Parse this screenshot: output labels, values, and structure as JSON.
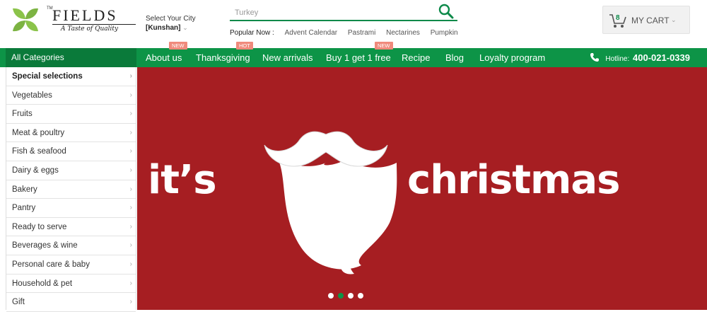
{
  "brand": {
    "tm": "TM",
    "name": "FIELDS",
    "tagline": "A Taste of Quality",
    "color": "#7cb342"
  },
  "city": {
    "label": "Select Your City",
    "current": "[Kunshan]"
  },
  "search": {
    "placeholder": "Turkey",
    "icon": "search-icon"
  },
  "popular": {
    "label": "Popular Now :",
    "tags": [
      "Advent Calendar",
      "Pastrami",
      "Nectarines",
      "Pumpkin"
    ]
  },
  "cart": {
    "count": "8",
    "label": "MY CART",
    "icon": "cart-icon"
  },
  "nav": {
    "all_categories": "All Categories",
    "items": [
      {
        "label": "About us",
        "badge": "NEW"
      },
      {
        "label": "Thanksgiving",
        "badge": "HOT"
      },
      {
        "label": "New arrivals",
        "badge": ""
      },
      {
        "label": "Buy 1 get 1 free",
        "badge": "NEW"
      },
      {
        "label": "Recipe",
        "badge": ""
      },
      {
        "label": "Blog",
        "badge": ""
      },
      {
        "label": "Loyalty program",
        "badge": ""
      }
    ],
    "hotline_label": "Hotline:",
    "hotline_number": "400-021-0339",
    "color": "#0d9447"
  },
  "categories": [
    "Special selections",
    "Vegetables",
    "Fruits",
    "Meat & poultry",
    "Fish & seafood",
    "Dairy & eggs",
    "Bakery",
    "Pantry",
    "Ready to serve",
    "Beverages & wine",
    "Personal care & baby",
    "Household & pet",
    "Gift"
  ],
  "banner": {
    "text_left": "it’s",
    "text_right": "christmas",
    "background": "#a61e22",
    "slide_count": 4,
    "active_slide": 2
  }
}
